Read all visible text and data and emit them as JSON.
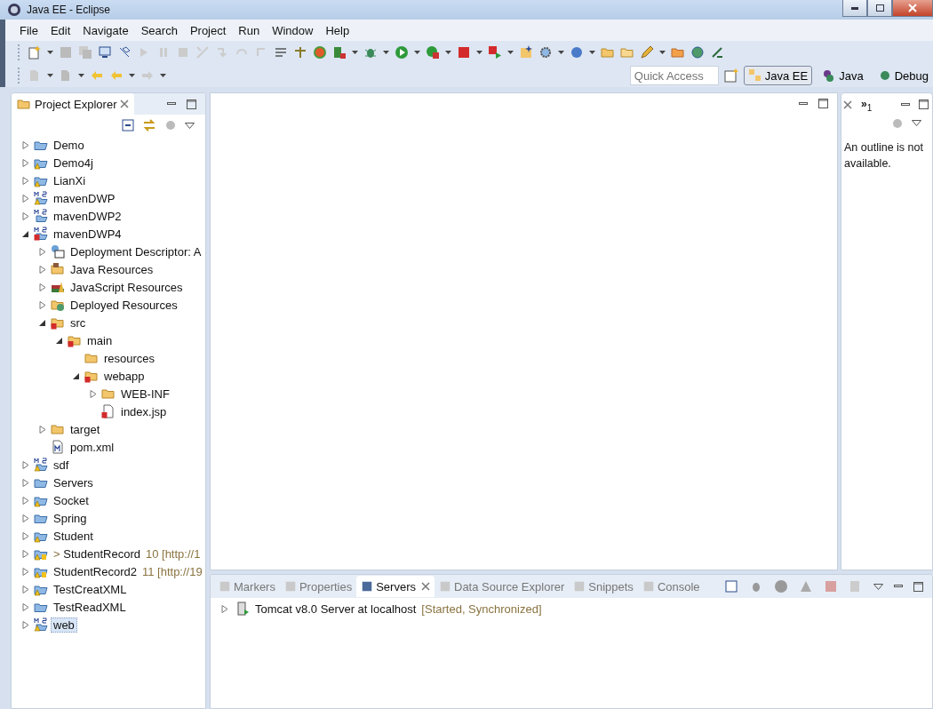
{
  "window": {
    "title": "Java EE - Eclipse"
  },
  "menu": [
    "File",
    "Edit",
    "Navigate",
    "Search",
    "Project",
    "Run",
    "Window",
    "Help"
  ],
  "quick_access": {
    "placeholder": "Quick Access"
  },
  "perspectives": [
    {
      "label": "Java EE",
      "selected": true
    },
    {
      "label": "Java",
      "selected": false
    },
    {
      "label": "Debug",
      "selected": false
    }
  ],
  "project_explorer": {
    "title": "Project Explorer",
    "tree": [
      {
        "label": "Demo",
        "kind": "project",
        "warning": false,
        "error": false,
        "expanded": false,
        "selected": false
      },
      {
        "label": "Demo4j",
        "kind": "project",
        "warning": true,
        "error": false,
        "expanded": false,
        "selected": false
      },
      {
        "label": "LianXi",
        "kind": "project",
        "warning": true,
        "error": false,
        "expanded": false,
        "selected": false
      },
      {
        "label": "mavenDWP",
        "kind": "maven",
        "warning": true,
        "error": false,
        "expanded": false,
        "selected": false
      },
      {
        "label": "mavenDWP2",
        "kind": "maven",
        "warning": false,
        "error": false,
        "expanded": false,
        "selected": false
      },
      {
        "label": "mavenDWP4",
        "kind": "maven",
        "warning": false,
        "error": true,
        "expanded": true,
        "selected": false,
        "children": [
          {
            "label": "Deployment Descriptor: A",
            "kind": "descriptor",
            "warning": false,
            "error": false,
            "expanded": false,
            "selected": false
          },
          {
            "label": "Java Resources",
            "kind": "resources",
            "warning": false,
            "error": false,
            "expanded": false,
            "selected": false
          },
          {
            "label": "JavaScript Resources",
            "kind": "books",
            "warning": false,
            "error": false,
            "expanded": false,
            "selected": false
          },
          {
            "label": "Deployed Resources",
            "kind": "deployed",
            "warning": false,
            "error": false,
            "expanded": false,
            "selected": false
          },
          {
            "label": "src",
            "kind": "folder",
            "warning": false,
            "error": true,
            "expanded": true,
            "selected": false,
            "children": [
              {
                "label": "main",
                "kind": "folder",
                "warning": false,
                "error": true,
                "expanded": true,
                "selected": false,
                "children": [
                  {
                    "label": "resources",
                    "kind": "folder",
                    "warning": false,
                    "error": false,
                    "selected": false
                  },
                  {
                    "label": "webapp",
                    "kind": "folder",
                    "warning": false,
                    "error": true,
                    "expanded": true,
                    "selected": false,
                    "children": [
                      {
                        "label": "WEB-INF",
                        "kind": "folder",
                        "warning": false,
                        "error": false,
                        "expanded": false,
                        "selected": false
                      },
                      {
                        "label": "index.jsp",
                        "kind": "file",
                        "warning": false,
                        "error": true,
                        "selected": false
                      }
                    ]
                  }
                ]
              }
            ]
          },
          {
            "label": "target",
            "kind": "folder",
            "warning": false,
            "error": false,
            "expanded": false,
            "selected": false
          },
          {
            "label": "pom.xml",
            "kind": "pom",
            "warning": false,
            "error": false,
            "selected": false
          }
        ]
      },
      {
        "label": "sdf",
        "kind": "maven",
        "warning": true,
        "error": false,
        "expanded": false,
        "selected": false
      },
      {
        "label": "Servers",
        "kind": "project",
        "warning": false,
        "error": false,
        "expanded": false,
        "selected": false
      },
      {
        "label": "Socket",
        "kind": "project",
        "warning": true,
        "error": false,
        "expanded": false,
        "selected": false
      },
      {
        "label": "Spring",
        "kind": "project",
        "warning": false,
        "error": false,
        "expanded": false,
        "selected": false
      },
      {
        "label": "Student",
        "kind": "project",
        "warning": true,
        "error": false,
        "expanded": false,
        "selected": false
      },
      {
        "label": "StudentRecord",
        "prefix": ">",
        "suffix": "10 [http://1",
        "kind": "repo",
        "warning": true,
        "error": false,
        "expanded": false,
        "selected": false
      },
      {
        "label": "StudentRecord2",
        "suffix": "11 [http://19",
        "kind": "repo",
        "warning": true,
        "error": false,
        "expanded": false,
        "selected": false
      },
      {
        "label": "TestCreatXML",
        "kind": "project",
        "warning": true,
        "error": false,
        "expanded": false,
        "selected": false
      },
      {
        "label": "TestReadXML",
        "kind": "project",
        "warning": false,
        "error": false,
        "expanded": false,
        "selected": false
      },
      {
        "label": "web",
        "kind": "maven",
        "warning": true,
        "error": false,
        "expanded": false,
        "selected": true
      }
    ]
  },
  "outline": {
    "overflow": "»",
    "overflow_count": "1",
    "message": "An outline is not available."
  },
  "bottom_panel": {
    "tabs": [
      {
        "label": "Markers",
        "selected": false
      },
      {
        "label": "Properties",
        "selected": false
      },
      {
        "label": "Servers",
        "selected": true
      },
      {
        "label": "Data Source Explorer",
        "selected": false
      },
      {
        "label": "Snippets",
        "selected": false
      },
      {
        "label": "Console",
        "selected": false
      }
    ],
    "servers": [
      {
        "name": "Tomcat v8.0 Server at localhost",
        "status": "[Started, Synchronized]",
        "expanded": false
      }
    ]
  }
}
